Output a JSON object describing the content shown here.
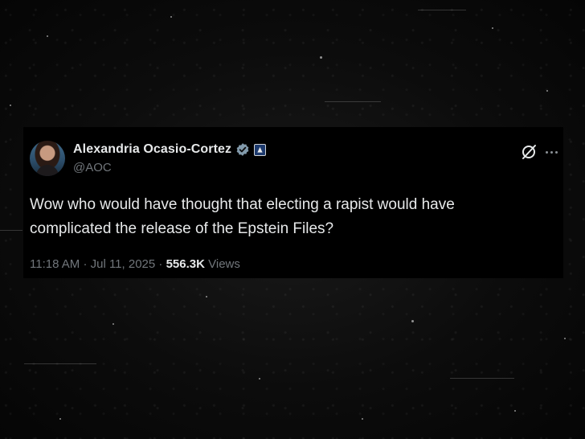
{
  "tweet": {
    "author": {
      "display_name": "Alexandria Ocasio-Cortez",
      "handle": "@AOC",
      "verified": true,
      "avatar_icon": "profile-photo"
    },
    "text_line1": "Wow who would have thought that electing a rapist would have",
    "text_line2": "complicated the release of the Epstein Files?",
    "time": "11:18 AM",
    "date": "Jul 11, 2025",
    "separator": "·",
    "views_count": "556.3K",
    "views_label": "Views",
    "icons": {
      "verified": "verified-check-icon",
      "affiliate": "government-affiliate-icon",
      "grok": "grok-icon",
      "more": "more-options-icon"
    },
    "colors": {
      "background": "#000000",
      "primary_text": "#e7e9ea",
      "secondary_text": "#71767b",
      "verified_badge": "#829aab"
    }
  }
}
